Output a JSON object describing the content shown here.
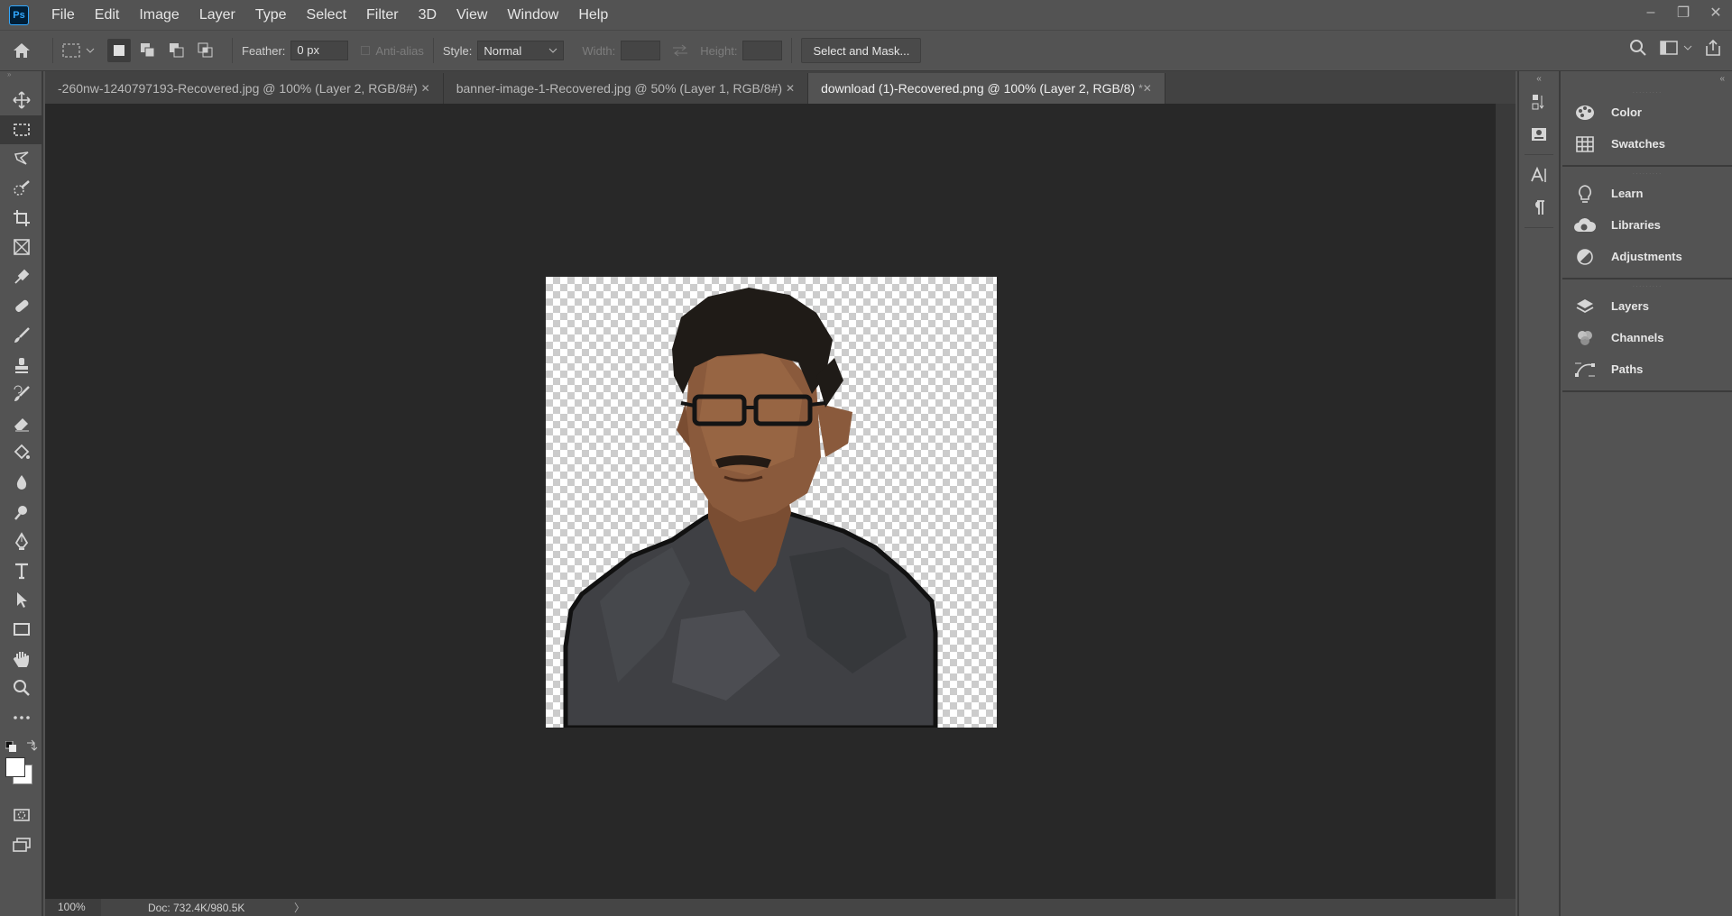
{
  "app": {
    "logo": "Ps"
  },
  "menu": [
    "File",
    "Edit",
    "Image",
    "Layer",
    "Type",
    "Select",
    "Filter",
    "3D",
    "View",
    "Window",
    "Help"
  ],
  "window_controls": {
    "minimize": "–",
    "restore": "❐",
    "close": "✕"
  },
  "options": {
    "feather_label": "Feather:",
    "feather_value": "0 px",
    "antialias_label": "Anti-alias",
    "style_label": "Style:",
    "style_value": "Normal",
    "width_label": "Width:",
    "height_label": "Height:",
    "select_mask_label": "Select and Mask..."
  },
  "tabs": [
    {
      "label": "-260nw-1240797193-Recovered.jpg @ 100% (Layer 2, RGB/8#)",
      "close": "✕",
      "active": false
    },
    {
      "label": "banner-image-1-Recovered.jpg @ 50% (Layer 1, RGB/8#)",
      "close": "✕",
      "active": false
    },
    {
      "label": "download (1)-Recovered.png @ 100% (Layer 2, RGB/8)",
      "close": "*✕",
      "active": true
    }
  ],
  "status": {
    "zoom": "100%",
    "doc": "Doc: 732.4K/980.5K",
    "arrow": "〉"
  },
  "panels": {
    "group1": [
      "Color",
      "Swatches"
    ],
    "group2": [
      "Learn",
      "Libraries",
      "Adjustments"
    ],
    "group3": [
      "Layers",
      "Channels",
      "Paths"
    ]
  },
  "colors": {
    "ui_bg": "#535353",
    "canvas_bg": "#282828",
    "shirt": "#3f4044",
    "hair": "#1f1b17",
    "skin": "#8a5a3c"
  }
}
